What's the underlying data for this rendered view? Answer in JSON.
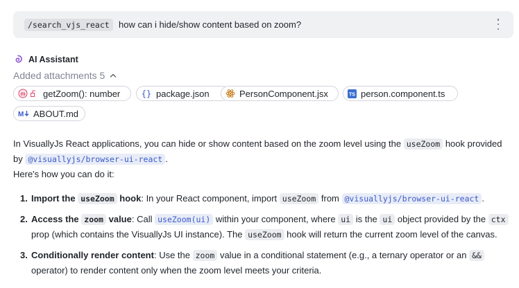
{
  "query": {
    "command": "/search_vjs_react",
    "text": "how can i hide/show content based on zoom?"
  },
  "assistant": {
    "name": "AI Assistant",
    "attachments_label": "Added attachments 5",
    "attachments": [
      {
        "label": "getZoom(): number",
        "icon": "method-icon"
      },
      {
        "label": "package.json",
        "icon": "json-file-icon"
      },
      {
        "label": "PersonComponent.jsx",
        "icon": "react-file-icon"
      },
      {
        "label": "person.component.ts",
        "icon": "typescript-file-icon"
      },
      {
        "label": "ABOUT.md",
        "icon": "markdown-file-icon"
      }
    ]
  },
  "answer": {
    "p1_a": "In VisuallyJs React applications, you can hide or show content based on the zoom level using the",
    "p1_code1": "useZoom",
    "p1_b": "hook provided by",
    "p1_code2": "@visuallyjs/browser-ui-react",
    "p1_c": ".",
    "p2": "Here's how you can do it:",
    "step1": {
      "num": "1.",
      "b1": "Import the",
      "code1": "useZoom",
      "b2": "hook",
      "t1": ": In your React component, import",
      "code2": "useZoom",
      "t2": "from",
      "code3": "@visuallyjs/browser-ui-react",
      "t3": "."
    },
    "step2": {
      "num": "2.",
      "b1": "Access the",
      "code1": "zoom",
      "b2": "value",
      "t1": ": Call",
      "code2": "useZoom(ui)",
      "t2": "within your component, where",
      "code3": "ui",
      "t3": "is the",
      "code4": "ui",
      "t4": "object provided by the",
      "code5": "ctx",
      "t5": "prop (which contains the VisuallyJs UI instance). The",
      "code6": "useZoom",
      "t6": "hook will return the current zoom level of the canvas."
    },
    "step3": {
      "num": "3.",
      "b1": "Conditionally render content",
      "t1": ": Use the",
      "code1": "zoom",
      "t2": "value in a conditional statement (e.g., a ternary operator or an",
      "code2": "&&",
      "t3": "operator) to render content only when the zoom level meets your criteria."
    }
  }
}
